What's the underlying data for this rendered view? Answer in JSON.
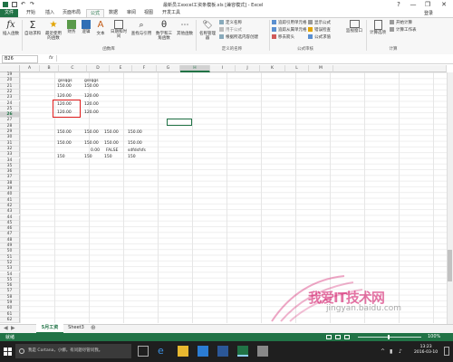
{
  "window": {
    "title": "最新员工excel工资条模板.xls [兼容模式] - Excel",
    "help": "?",
    "minimize": "—",
    "restore": "❐",
    "close": "✕"
  },
  "tabs": [
    {
      "label": "文件"
    },
    {
      "label": "开始"
    },
    {
      "label": "插入"
    },
    {
      "label": "页面布局"
    },
    {
      "label": "公式"
    },
    {
      "label": "数据"
    },
    {
      "label": "审阅"
    },
    {
      "label": "视图"
    },
    {
      "label": "开发工具"
    }
  ],
  "login": "登录",
  "ribbon": {
    "insert_function": "插入函数",
    "autosum": "自动求和",
    "recent": "最近使用的函数",
    "financial": "财务",
    "logical": "逻辑",
    "text": "文本",
    "datetime": "日期和时间",
    "lookup": "查找与引用",
    "math": "数学和三角函数",
    "other": "其他函数",
    "group_library": "函数库",
    "name_manager": "名称管理器",
    "define_name": "定义名称",
    "use_in_formula": "用于公式",
    "create_from_selection": "根据所选内容创建",
    "group_names": "定义的名称",
    "trace_precedents": "追踪引用单元格",
    "trace_dependents": "追踪从属单元格",
    "remove_arrows": "移去箭头",
    "show_formulas": "显示公式",
    "error_checking": "错误检查",
    "evaluate_formula": "公式求值",
    "group_audit": "公式审核",
    "watch_window": "监视窗口",
    "calc_options": "计算选项",
    "calc_now": "开始计算",
    "calc_sheet": "计算工作表",
    "group_calc": "计算"
  },
  "formula_bar": {
    "name_box": "B26",
    "fx": "fx",
    "value": ""
  },
  "columns": [
    "A",
    "B",
    "C",
    "D",
    "E",
    "F",
    "G",
    "H",
    "I",
    "J",
    "K",
    "L",
    "M"
  ],
  "rows": [
    "19",
    "20",
    "21",
    "22",
    "23",
    "24",
    "25",
    "26",
    "27",
    "28",
    "29",
    "30",
    "31",
    "32",
    "33",
    "34",
    "35",
    "36",
    "37",
    "38",
    "39",
    "40",
    "41",
    "42",
    "43",
    "44",
    "45",
    "46",
    "47",
    "48",
    "49",
    "50",
    "51",
    "52",
    "53",
    "54",
    "55",
    "56",
    "57",
    "58",
    "59",
    "60",
    "61",
    "62",
    "63"
  ],
  "cells": {
    "c20": "gssqgs",
    "d20": "gssqgs",
    "c21": "150.00",
    "d21": "150.00",
    "c22": "120.00",
    "d22": "120.00",
    "c23": "120.00",
    "d23": "120.00",
    "c24": "120.00",
    "d24": "120.00",
    "c27": "150.00",
    "d27": "150.00",
    "e27": "150.00",
    "f27": "150.00",
    "c28": "150.00",
    "d28": "150.00",
    "e28": "150.00",
    "f28": "150.00",
    "d29": "0.00",
    "e29": "FALSE",
    "f29": "sdfdsfsfs",
    "c30": "150",
    "d30": "150",
    "e30": "150",
    "f30": "150"
  },
  "sheets": [
    {
      "label": "5月工资"
    },
    {
      "label": "Sheet3"
    }
  ],
  "add_sheet": "⊕",
  "status": {
    "ready": "就绪",
    "zoom": "100%"
  },
  "taskbar": {
    "search_placeholder": "我是 Cortana，小娜。有问题尽管问我。",
    "time": "13:23",
    "date": "2016-03-10"
  },
  "watermark": {
    "text": "我爱IT技术网",
    "url": "jingyan.baidu.com"
  },
  "colors": {
    "excel_green": "#217346",
    "highlight_red": "#e01a1a"
  }
}
